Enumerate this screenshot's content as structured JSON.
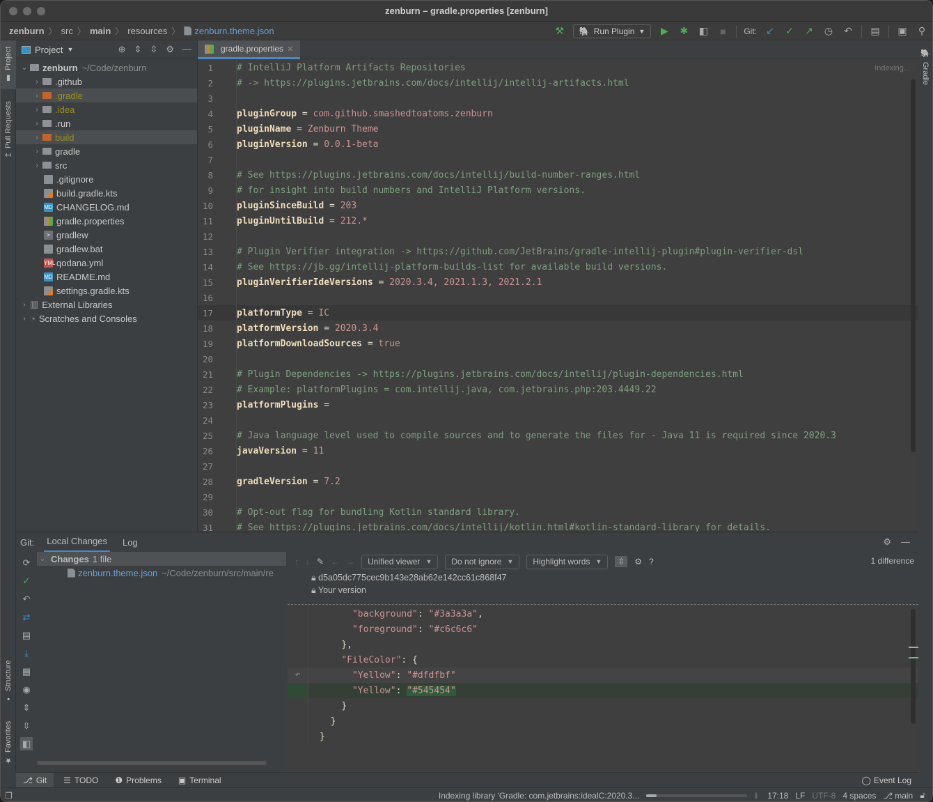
{
  "window": {
    "title": "zenburn – gradle.properties [zenburn]"
  },
  "breadcrumb": [
    "zenburn",
    "src",
    "main",
    "resources",
    "zenburn.theme.json"
  ],
  "toolbar": {
    "run_config": "Run Plugin",
    "git_label": "Git:"
  },
  "left_strip": {
    "project": "Project",
    "pull_requests": "Pull Requests",
    "structure": "Structure",
    "favorites": "Favorites"
  },
  "right_strip": {
    "gradle": "Gradle"
  },
  "project_panel": {
    "title": "Project",
    "root": {
      "name": "zenburn",
      "path": "~/Code/zenburn"
    },
    "items": [
      {
        "name": ".github",
        "type": "folder"
      },
      {
        "name": ".gradle",
        "type": "folder-excluded"
      },
      {
        "name": ".idea",
        "type": "folder-ignored"
      },
      {
        "name": ".run",
        "type": "folder"
      },
      {
        "name": "build",
        "type": "folder-excluded"
      },
      {
        "name": "gradle",
        "type": "folder"
      },
      {
        "name": "src",
        "type": "folder"
      },
      {
        "name": ".gitignore",
        "type": "file"
      },
      {
        "name": "build.gradle.kts",
        "type": "kts"
      },
      {
        "name": "CHANGELOG.md",
        "type": "md"
      },
      {
        "name": "gradle.properties",
        "type": "properties"
      },
      {
        "name": "gradlew",
        "type": "shell"
      },
      {
        "name": "gradlew.bat",
        "type": "text"
      },
      {
        "name": "qodana.yml",
        "type": "yml"
      },
      {
        "name": "README.md",
        "type": "md"
      },
      {
        "name": "settings.gradle.kts",
        "type": "kts"
      }
    ],
    "external_libraries": "External Libraries",
    "scratches": "Scratches and Consoles"
  },
  "editor": {
    "tab": "gradle.properties",
    "status": "Indexing...",
    "current_line": 17,
    "lines": [
      {
        "n": "1",
        "c": "# IntelliJ Platform Artifacts Repositories"
      },
      {
        "n": "2",
        "c": "# -> https://plugins.jetbrains.com/docs/intellij/intellij-artifacts.html"
      },
      {
        "n": "3"
      },
      {
        "n": "4",
        "k": "pluginGroup",
        "v": "com.github.smashedtoatoms.zenburn"
      },
      {
        "n": "5",
        "k": "pluginName",
        "v": "Zenburn Theme"
      },
      {
        "n": "6",
        "k": "pluginVersion",
        "v": "0.0.1-beta"
      },
      {
        "n": "7"
      },
      {
        "n": "8",
        "c": "# See https://plugins.jetbrains.com/docs/intellij/build-number-ranges.html"
      },
      {
        "n": "9",
        "c": "# for insight into build numbers and IntelliJ Platform versions."
      },
      {
        "n": "10",
        "k": "pluginSinceBuild",
        "v": "203"
      },
      {
        "n": "11",
        "k": "pluginUntilBuild",
        "v": "212.*"
      },
      {
        "n": "12"
      },
      {
        "n": "13",
        "c": "# Plugin Verifier integration -> https://github.com/JetBrains/gradle-intellij-plugin#plugin-verifier-dsl"
      },
      {
        "n": "14",
        "c": "# See https://jb.gg/intellij-platform-builds-list for available build versions."
      },
      {
        "n": "15",
        "k": "pluginVerifierIdeVersions",
        "v": "2020.3.4, 2021.1.3, 2021.2.1"
      },
      {
        "n": "16"
      },
      {
        "n": "17",
        "k": "platformType",
        "v": "IC"
      },
      {
        "n": "18",
        "k": "platformVersion",
        "v": "2020.3.4"
      },
      {
        "n": "19",
        "k": "platformDownloadSources",
        "v": "true"
      },
      {
        "n": "20"
      },
      {
        "n": "21",
        "c": "# Plugin Dependencies -> https://plugins.jetbrains.com/docs/intellij/plugin-dependencies.html"
      },
      {
        "n": "22",
        "c": "# Example: platformPlugins = com.intellij.java, com.jetbrains.php:203.4449.22"
      },
      {
        "n": "23",
        "k": "platformPlugins",
        "v": ""
      },
      {
        "n": "24"
      },
      {
        "n": "25",
        "c": "# Java language level used to compile sources and to generate the files for - Java 11 is required since 2020.3"
      },
      {
        "n": "26",
        "k": "javaVersion",
        "v": "11"
      },
      {
        "n": "27"
      },
      {
        "n": "28",
        "k": "gradleVersion",
        "v": "7.2"
      },
      {
        "n": "29"
      },
      {
        "n": "30",
        "c": "# Opt-out flag for bundling Kotlin standard library."
      },
      {
        "n": "31",
        "c": "# See https://plugins.jetbrains.com/docs/intellij/kotlin.html#kotlin-standard-library for details."
      }
    ]
  },
  "git_panel": {
    "label": "Git:",
    "tabs": [
      "Local Changes",
      "Log"
    ],
    "changes_header": "Changes",
    "changes_count": "1 file",
    "changed_file": {
      "name": "zenburn.theme.json",
      "path": "~/Code/zenburn/src/main/re"
    },
    "diff": {
      "viewer": "Unified viewer",
      "ignore": "Do not ignore",
      "highlight": "Highlight words",
      "difference_count": "1 difference",
      "revision": "d5a05dc775cec9b143e28ab62e142cc61c868f47",
      "your_version": "Your version",
      "lines": [
        {
          "type": "ctx",
          "indent": "      ",
          "key": "\"background\"",
          "val": "\"#3a3a3a\"",
          "tail": ","
        },
        {
          "type": "ctx",
          "indent": "      ",
          "key": "\"foreground\"",
          "val": "\"#c6c6c6\"",
          "tail": ""
        },
        {
          "type": "ctx",
          "indent": "    ",
          "raw": "},"
        },
        {
          "type": "ctx",
          "indent": "    ",
          "key": "\"FileColor\"",
          "raw2": ": {"
        },
        {
          "type": "del",
          "indent": "      ",
          "key": "\"Yellow\"",
          "val": "\"#dfdfbf\"",
          "tail": ""
        },
        {
          "type": "add",
          "indent": "      ",
          "key": "\"Yellow\"",
          "val": "\"#545454\"",
          "tail": ""
        },
        {
          "type": "ctx",
          "indent": "    ",
          "raw": "}"
        },
        {
          "type": "ctx",
          "indent": "  ",
          "raw": "}"
        },
        {
          "type": "ctx",
          "indent": "",
          "raw": "}"
        }
      ]
    }
  },
  "bottom_tabs": [
    "Git",
    "TODO",
    "Problems",
    "Terminal"
  ],
  "event_log": "Event Log",
  "statusbar": {
    "indexing": "Indexing library 'Gradle: com.jetbrains:idealC:2020.3...",
    "progress": 0.1,
    "position": "17:18",
    "line_sep": "LF",
    "encoding": "UTF-8",
    "indent": "4 spaces",
    "branch": "main"
  }
}
